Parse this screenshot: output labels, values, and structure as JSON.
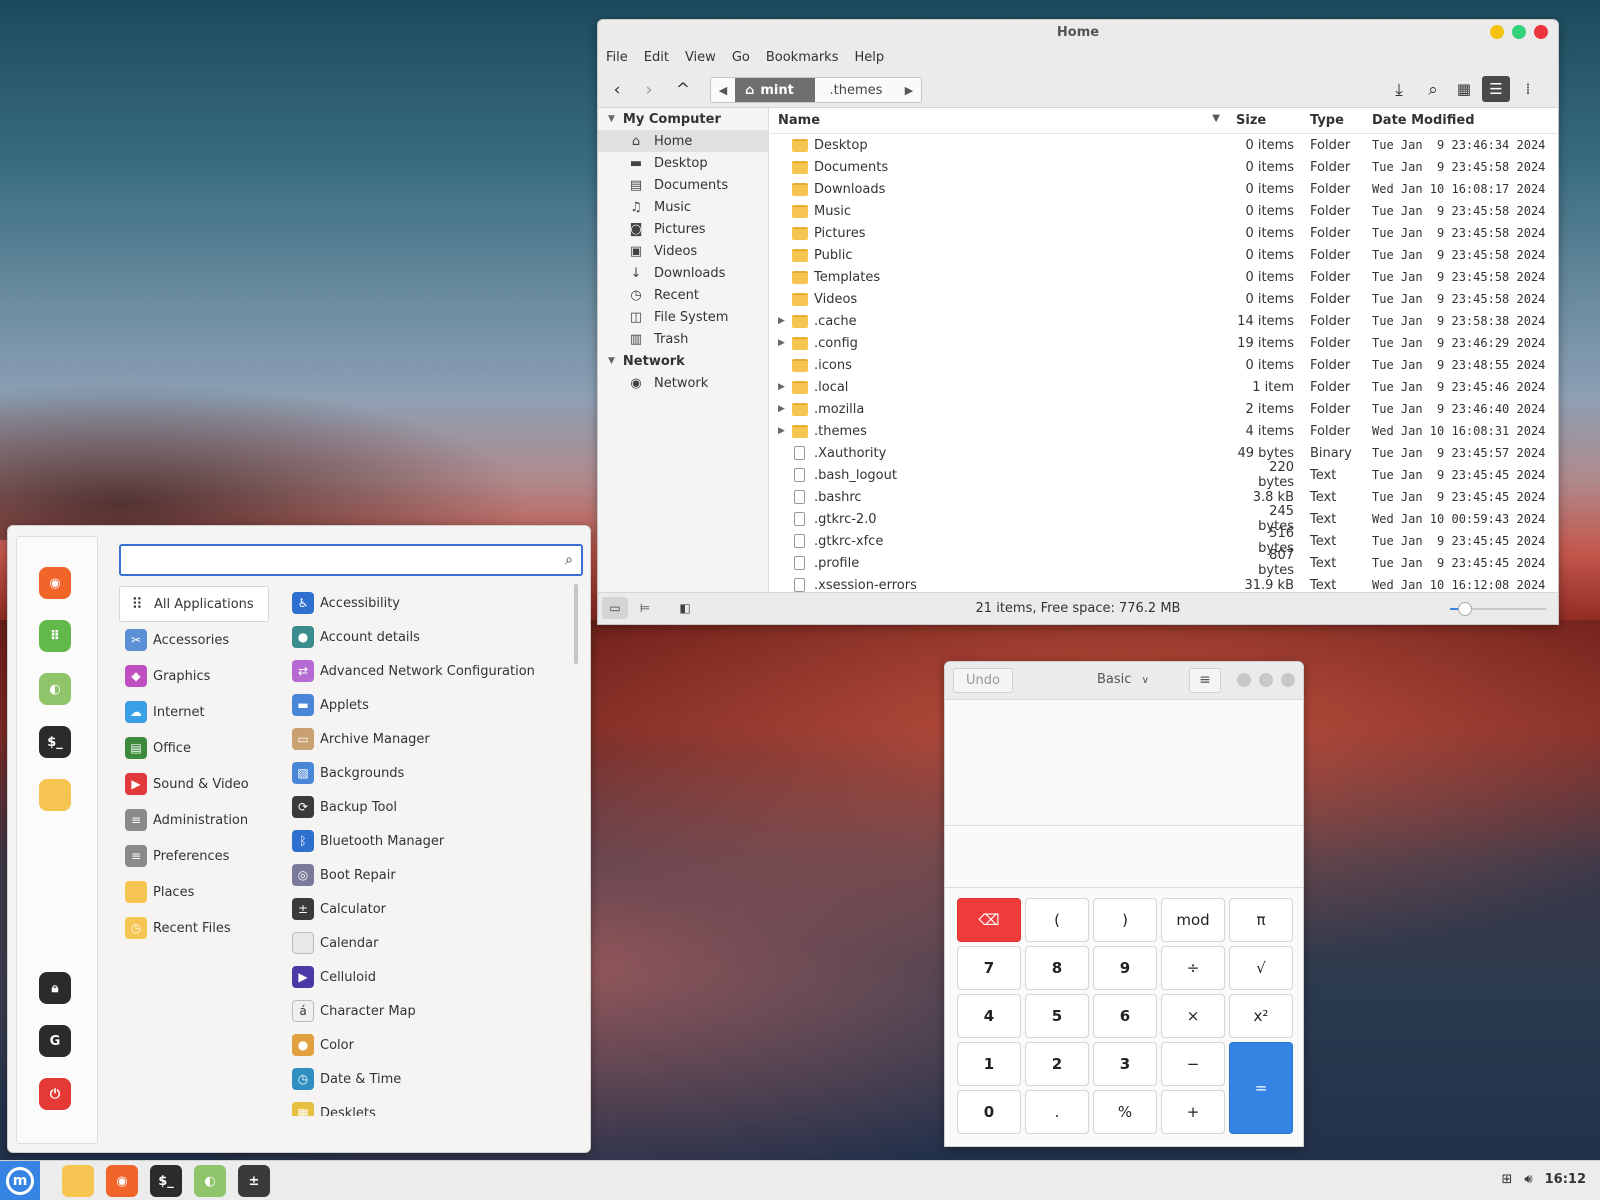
{
  "file_manager": {
    "title": "Home",
    "menu": [
      "File",
      "Edit",
      "View",
      "Go",
      "Bookmarks",
      "Help"
    ],
    "path": {
      "home_label": "mint",
      "next_label": ".themes"
    },
    "sidebar": {
      "sections": [
        {
          "label": "My Computer",
          "items": [
            {
              "label": "Home",
              "icon": "home-icon",
              "glyph": "⌂",
              "selected": true
            },
            {
              "label": "Desktop",
              "icon": "desktop-icon",
              "glyph": "▬"
            },
            {
              "label": "Documents",
              "icon": "documents-icon",
              "glyph": "▤"
            },
            {
              "label": "Music",
              "icon": "music-icon",
              "glyph": "♫"
            },
            {
              "label": "Pictures",
              "icon": "pictures-icon",
              "glyph": "◙"
            },
            {
              "label": "Videos",
              "icon": "videos-icon",
              "glyph": "▣"
            },
            {
              "label": "Downloads",
              "icon": "downloads-icon",
              "glyph": "↓"
            },
            {
              "label": "Recent",
              "icon": "recent-icon",
              "glyph": "◷"
            },
            {
              "label": "File System",
              "icon": "filesystem-icon",
              "glyph": "◫"
            },
            {
              "label": "Trash",
              "icon": "trash-icon",
              "glyph": "▥"
            }
          ]
        },
        {
          "label": "Network",
          "items": [
            {
              "label": "Network",
              "icon": "network-icon",
              "glyph": "◉"
            }
          ]
        }
      ]
    },
    "columns": {
      "name": "Name",
      "size": "Size",
      "type": "Type",
      "date": "Date Modified"
    },
    "rows": [
      {
        "name": "Desktop",
        "size": "0 items",
        "type": "Folder",
        "date": "Tue Jan  9 23:46:34 2024",
        "kind": "folder",
        "expandable": false
      },
      {
        "name": "Documents",
        "size": "0 items",
        "type": "Folder",
        "date": "Tue Jan  9 23:45:58 2024",
        "kind": "folder",
        "expandable": false
      },
      {
        "name": "Downloads",
        "size": "0 items",
        "type": "Folder",
        "date": "Wed Jan 10 16:08:17 2024",
        "kind": "folder",
        "expandable": false
      },
      {
        "name": "Music",
        "size": "0 items",
        "type": "Folder",
        "date": "Tue Jan  9 23:45:58 2024",
        "kind": "folder",
        "expandable": false
      },
      {
        "name": "Pictures",
        "size": "0 items",
        "type": "Folder",
        "date": "Tue Jan  9 23:45:58 2024",
        "kind": "folder",
        "expandable": false
      },
      {
        "name": "Public",
        "size": "0 items",
        "type": "Folder",
        "date": "Tue Jan  9 23:45:58 2024",
        "kind": "folder",
        "expandable": false
      },
      {
        "name": "Templates",
        "size": "0 items",
        "type": "Folder",
        "date": "Tue Jan  9 23:45:58 2024",
        "kind": "folder",
        "expandable": false
      },
      {
        "name": "Videos",
        "size": "0 items",
        "type": "Folder",
        "date": "Tue Jan  9 23:45:58 2024",
        "kind": "folder",
        "expandable": false
      },
      {
        "name": ".cache",
        "size": "14 items",
        "type": "Folder",
        "date": "Tue Jan  9 23:58:38 2024",
        "kind": "folder",
        "expandable": true
      },
      {
        "name": ".config",
        "size": "19 items",
        "type": "Folder",
        "date": "Tue Jan  9 23:46:29 2024",
        "kind": "folder",
        "expandable": true
      },
      {
        "name": ".icons",
        "size": "0 items",
        "type": "Folder",
        "date": "Tue Jan  9 23:48:55 2024",
        "kind": "folder",
        "expandable": false
      },
      {
        "name": ".local",
        "size": "1 item",
        "type": "Folder",
        "date": "Tue Jan  9 23:45:46 2024",
        "kind": "folder",
        "expandable": true
      },
      {
        "name": ".mozilla",
        "size": "2 items",
        "type": "Folder",
        "date": "Tue Jan  9 23:46:40 2024",
        "kind": "folder",
        "expandable": true
      },
      {
        "name": ".themes",
        "size": "4 items",
        "type": "Folder",
        "date": "Wed Jan 10 16:08:31 2024",
        "kind": "folder",
        "expandable": true
      },
      {
        "name": ".Xauthority",
        "size": "49 bytes",
        "type": "Binary",
        "date": "Tue Jan  9 23:45:57 2024",
        "kind": "file",
        "expandable": false
      },
      {
        "name": ".bash_logout",
        "size": "220 bytes",
        "type": "Text",
        "date": "Tue Jan  9 23:45:45 2024",
        "kind": "file",
        "expandable": false
      },
      {
        "name": ".bashrc",
        "size": "3.8 kB",
        "type": "Text",
        "date": "Tue Jan  9 23:45:45 2024",
        "kind": "file",
        "expandable": false
      },
      {
        "name": ".gtkrc-2.0",
        "size": "245 bytes",
        "type": "Text",
        "date": "Wed Jan 10 00:59:43 2024",
        "kind": "file",
        "expandable": false
      },
      {
        "name": ".gtkrc-xfce",
        "size": "516 bytes",
        "type": "Text",
        "date": "Tue Jan  9 23:45:45 2024",
        "kind": "file",
        "expandable": false
      },
      {
        "name": ".profile",
        "size": "807 bytes",
        "type": "Text",
        "date": "Tue Jan  9 23:45:45 2024",
        "kind": "file",
        "expandable": false
      },
      {
        "name": ".xsession-errors",
        "size": "31.9 kB",
        "type": "Text",
        "date": "Wed Jan 10 16:12:08 2024",
        "kind": "file",
        "expandable": false
      }
    ],
    "status": "21 items, Free space: 776.2 MB",
    "zoom_level": 0.1
  },
  "menu": {
    "search": {
      "value": "",
      "placeholder": ""
    },
    "favorites": [
      {
        "name": "firefox-icon",
        "color": "#f1642a"
      },
      {
        "name": "software-manager-icon",
        "color": "#63b84a"
      },
      {
        "name": "settings-icon",
        "color": "#8fc46a"
      },
      {
        "name": "terminal-icon",
        "color": "#2b2b2b"
      },
      {
        "name": "files-icon",
        "color": "#f5c451"
      },
      {
        "name": "lock-icon",
        "color": "#2b2b2b"
      },
      {
        "name": "logout-icon",
        "color": "#2b2b2b"
      },
      {
        "name": "power-icon",
        "color": "#e53935"
      }
    ],
    "categories": [
      {
        "label": "All Applications",
        "icon": "grid-icon",
        "color": "#ffffff",
        "glyph": "⠿",
        "selected": true
      },
      {
        "label": "Accessories",
        "icon": "accessories-icon",
        "color": "#5b8fd6",
        "glyph": "✂"
      },
      {
        "label": "Graphics",
        "icon": "graphics-icon",
        "color": "#c04fc2",
        "glyph": "◆"
      },
      {
        "label": "Internet",
        "icon": "internet-icon",
        "color": "#3aa0e6",
        "glyph": "☁"
      },
      {
        "label": "Office",
        "icon": "office-icon",
        "color": "#3d8b3d",
        "glyph": "▤"
      },
      {
        "label": "Sound & Video",
        "icon": "sound-video-icon",
        "color": "#e03a3a",
        "glyph": "▶"
      },
      {
        "label": "Administration",
        "icon": "administration-icon",
        "color": "#8a8a8a",
        "glyph": "≡"
      },
      {
        "label": "Preferences",
        "icon": "preferences-icon",
        "color": "#8a8a8a",
        "glyph": "≡"
      },
      {
        "label": "Places",
        "icon": "places-icon",
        "color": "#f5c451",
        "glyph": ""
      },
      {
        "label": "Recent Files",
        "icon": "recent-files-icon",
        "color": "#f5c451",
        "glyph": "◷"
      }
    ],
    "apps": [
      {
        "label": "Accessibility",
        "icon": "accessibility-icon",
        "color": "#2f6fd0",
        "glyph": "♿"
      },
      {
        "label": "Account details",
        "icon": "account-icon",
        "color": "#3b8c8c",
        "glyph": "●"
      },
      {
        "label": "Advanced Network Configuration",
        "icon": "network-config-icon",
        "color": "#b76ad1",
        "glyph": "⇄"
      },
      {
        "label": "Applets",
        "icon": "applets-icon",
        "color": "#4a86d8",
        "glyph": "▬"
      },
      {
        "label": "Archive Manager",
        "icon": "archive-icon",
        "color": "#c9a070",
        "glyph": "▭"
      },
      {
        "label": "Backgrounds",
        "icon": "backgrounds-icon",
        "color": "#4a86d8",
        "glyph": "▨"
      },
      {
        "label": "Backup Tool",
        "icon": "backup-icon",
        "color": "#3a3a3a",
        "glyph": "⟳"
      },
      {
        "label": "Bluetooth Manager",
        "icon": "bluetooth-icon",
        "color": "#2f6fd0",
        "glyph": "ᛒ"
      },
      {
        "label": "Boot Repair",
        "icon": "boot-repair-icon",
        "color": "#7a7a9a",
        "glyph": "◎"
      },
      {
        "label": "Calculator",
        "icon": "calculator-icon",
        "color": "#3a3a3a",
        "glyph": "±"
      },
      {
        "label": "Calendar",
        "icon": "calendar-icon",
        "color": "#e8e8e8",
        "glyph": ""
      },
      {
        "label": "Celluloid",
        "icon": "celluloid-icon",
        "color": "#4a3aa8",
        "glyph": "▶"
      },
      {
        "label": "Character Map",
        "icon": "character-map-icon",
        "color": "#f0f0f0",
        "glyph": "á"
      },
      {
        "label": "Color",
        "icon": "color-icon",
        "color": "#e0a040",
        "glyph": "●"
      },
      {
        "label": "Date & Time",
        "icon": "date-time-icon",
        "color": "#2f8fc0",
        "glyph": "◷"
      },
      {
        "label": "Desklets",
        "icon": "desklets-icon",
        "color": "#e8c040",
        "glyph": "▦"
      }
    ]
  },
  "calculator": {
    "undo_label": "Undo",
    "mode_label": "Basic",
    "keys": [
      {
        "label": "⌫",
        "name": "backspace-key",
        "cls": "del",
        "col": 0,
        "row": 0
      },
      {
        "label": "(",
        "name": "open-paren-key",
        "cls": "",
        "col": 1,
        "row": 0
      },
      {
        "label": ")",
        "name": "close-paren-key",
        "cls": "",
        "col": 2,
        "row": 0
      },
      {
        "label": "mod",
        "name": "mod-key",
        "cls": "",
        "col": 3,
        "row": 0
      },
      {
        "label": "π",
        "name": "pi-key",
        "cls": "",
        "col": 4,
        "row": 0
      },
      {
        "label": "7",
        "name": "seven-key",
        "cls": "num",
        "col": 0,
        "row": 1
      },
      {
        "label": "8",
        "name": "eight-key",
        "cls": "num",
        "col": 1,
        "row": 1
      },
      {
        "label": "9",
        "name": "nine-key",
        "cls": "num",
        "col": 2,
        "row": 1
      },
      {
        "label": "÷",
        "name": "divide-key",
        "cls": "",
        "col": 3,
        "row": 1
      },
      {
        "label": "√",
        "name": "sqrt-key",
        "cls": "",
        "col": 4,
        "row": 1
      },
      {
        "label": "4",
        "name": "four-key",
        "cls": "num",
        "col": 0,
        "row": 2
      },
      {
        "label": "5",
        "name": "five-key",
        "cls": "num",
        "col": 1,
        "row": 2
      },
      {
        "label": "6",
        "name": "six-key",
        "cls": "num",
        "col": 2,
        "row": 2
      },
      {
        "label": "×",
        "name": "multiply-key",
        "cls": "",
        "col": 3,
        "row": 2
      },
      {
        "label": "x²",
        "name": "square-key",
        "cls": "",
        "col": 4,
        "row": 2
      },
      {
        "label": "1",
        "name": "one-key",
        "cls": "num",
        "col": 0,
        "row": 3
      },
      {
        "label": "2",
        "name": "two-key",
        "cls": "num",
        "col": 1,
        "row": 3
      },
      {
        "label": "3",
        "name": "three-key",
        "cls": "num",
        "col": 2,
        "row": 3
      },
      {
        "label": "−",
        "name": "minus-key",
        "cls": "",
        "col": 3,
        "row": 3
      },
      {
        "label": "=",
        "name": "equals-key",
        "cls": "eq",
        "col": 4,
        "row": 3
      },
      {
        "label": "0",
        "name": "zero-key",
        "cls": "num",
        "col": 0,
        "row": 4
      },
      {
        "label": ".",
        "name": "decimal-key",
        "cls": "",
        "col": 1,
        "row": 4
      },
      {
        "label": "%",
        "name": "percent-key",
        "cls": "",
        "col": 2,
        "row": 4
      },
      {
        "label": "+",
        "name": "plus-key",
        "cls": "",
        "col": 3,
        "row": 4
      }
    ]
  },
  "taskbar": {
    "apps": [
      {
        "name": "taskbar-files-icon",
        "color": "#f5c451"
      },
      {
        "name": "taskbar-firefox-icon",
        "color": "#f1642a"
      },
      {
        "name": "taskbar-terminal-icon",
        "color": "#2b2b2b"
      },
      {
        "name": "taskbar-settings-icon",
        "color": "#8fc46a"
      },
      {
        "name": "taskbar-calculator-icon",
        "color": "#3a3a3a"
      }
    ],
    "clock": "16:12"
  }
}
